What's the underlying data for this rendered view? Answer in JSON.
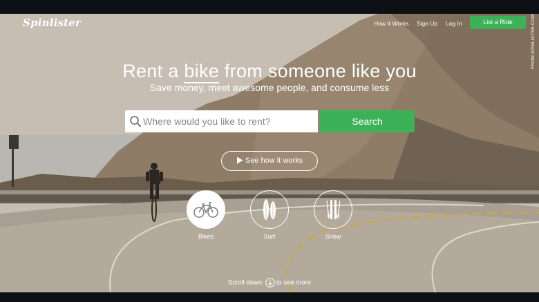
{
  "nav": {
    "logo": "Spinlister",
    "how_it_works": "How It Works",
    "sign_up": "Sign Up",
    "log_in": "Log In",
    "list_ride": "List a Ride"
  },
  "hero": {
    "headline_before": "Rent a ",
    "headline_word": "bike",
    "headline_after": " from someone like you",
    "subhead": "Save money, meet awesome people, and consume less"
  },
  "search": {
    "placeholder": "Where would you like to rent?",
    "value": "",
    "button": "Search"
  },
  "see_how": "See how it works",
  "categories": [
    {
      "label": "Bikes",
      "icon": "bike-icon",
      "selected": true
    },
    {
      "label": "Surf",
      "icon": "surfboard-icon",
      "selected": false
    },
    {
      "label": "Snow",
      "icon": "ski-icon",
      "selected": false
    }
  ],
  "scroll": {
    "before": "Scroll down",
    "after": "to see more"
  },
  "credit": "FROM SPINLISTER.COM",
  "colors": {
    "accent": "#3db158",
    "text": "#ffffff"
  }
}
